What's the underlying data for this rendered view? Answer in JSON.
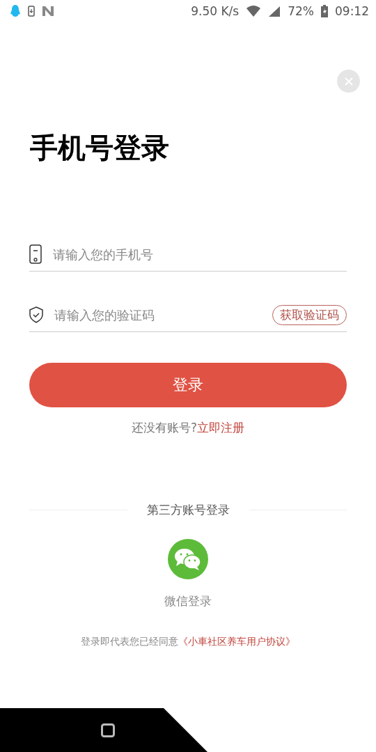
{
  "status_bar": {
    "speed": "9.50 K/s",
    "battery": "72%",
    "time": "09:12"
  },
  "title": "手机号登录",
  "phone_field": {
    "placeholder": "请输入您的手机号"
  },
  "code_field": {
    "placeholder": "请输入您的验证码"
  },
  "get_code_button": "获取验证码",
  "login_button": "登录",
  "register": {
    "prompt": "还没有账号?",
    "link": "立即注册"
  },
  "third_party": {
    "heading": "第三方账号登录",
    "wechat_label": "微信登录"
  },
  "agreement": {
    "text": "登录即代表您已经同意",
    "link": "《小車社区养车用户协议》"
  }
}
